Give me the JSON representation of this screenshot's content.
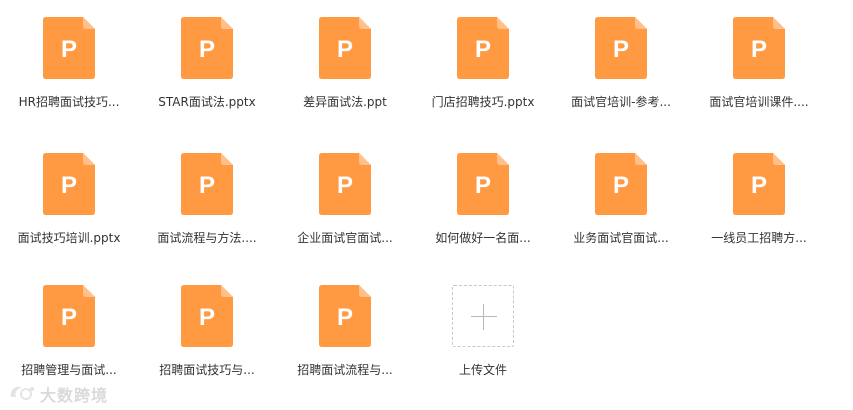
{
  "files": [
    {
      "name": "HR招聘面试技巧...",
      "icon": "ppt-file-icon",
      "letter": "P"
    },
    {
      "name": "STAR面试法.pptx",
      "icon": "ppt-file-icon",
      "letter": "P"
    },
    {
      "name": "差异面试法.ppt",
      "icon": "ppt-file-icon",
      "letter": "P"
    },
    {
      "name": "门店招聘技巧.pptx",
      "icon": "ppt-file-icon",
      "letter": "P"
    },
    {
      "name": "面试官培训-参考...",
      "icon": "ppt-file-icon",
      "letter": "P"
    },
    {
      "name": "面试官培训课件....",
      "icon": "ppt-file-icon",
      "letter": "P"
    },
    {
      "name": "面试技巧培训.pptx",
      "icon": "ppt-file-icon",
      "letter": "P"
    },
    {
      "name": "面试流程与方法....",
      "icon": "ppt-file-icon",
      "letter": "P"
    },
    {
      "name": "企业面试官面试...",
      "icon": "ppt-file-icon",
      "letter": "P"
    },
    {
      "name": "如何做好一名面...",
      "icon": "ppt-file-icon",
      "letter": "P"
    },
    {
      "name": "业务面试官面试...",
      "icon": "ppt-file-icon",
      "letter": "P"
    },
    {
      "name": "一线员工招聘方...",
      "icon": "ppt-file-icon",
      "letter": "P"
    },
    {
      "name": "招聘管理与面试...",
      "icon": "ppt-file-icon",
      "letter": "P"
    },
    {
      "name": "招聘面试技巧与...",
      "icon": "ppt-file-icon",
      "letter": "P"
    },
    {
      "name": "招聘面试流程与...",
      "icon": "ppt-file-icon",
      "letter": "P"
    }
  ],
  "upload": {
    "label": "上传文件",
    "icon": "plus-icon"
  },
  "watermark": {
    "text": "大数跨境",
    "icon": "watermark-logo-icon"
  },
  "colors": {
    "file_icon": "#ff9a43",
    "file_icon_fold": "#ffc08a",
    "letter": "#ffffff",
    "text": "#333333",
    "upload_border": "#c8c8c8"
  }
}
